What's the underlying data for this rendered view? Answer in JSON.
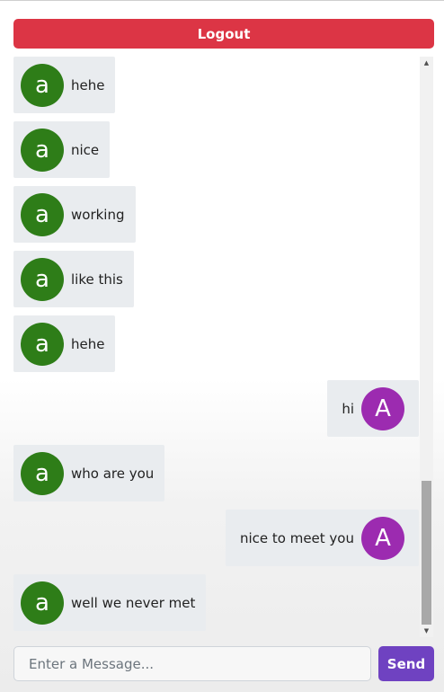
{
  "header": {
    "logout_label": "Logout"
  },
  "chat": {
    "messages": [
      {
        "side": "left",
        "avatar": "a",
        "text": "hehe"
      },
      {
        "side": "left",
        "avatar": "a",
        "text": "nice"
      },
      {
        "side": "left",
        "avatar": "a",
        "text": "working"
      },
      {
        "side": "left",
        "avatar": "a",
        "text": "like this"
      },
      {
        "side": "left",
        "avatar": "a",
        "text": "hehe"
      },
      {
        "side": "right",
        "avatar": "A",
        "text": "hi"
      },
      {
        "side": "left",
        "avatar": "a",
        "text": "who are you"
      },
      {
        "side": "right",
        "avatar": "A",
        "text": "nice to meet you"
      },
      {
        "side": "left",
        "avatar": "a",
        "text": "well we never met"
      }
    ]
  },
  "composer": {
    "placeholder": "Enter a Message...",
    "value": "",
    "send_label": "Send"
  },
  "colors": {
    "logout": "#dc3545",
    "send": "#6f42c1",
    "avatar_other": "#2e7d18",
    "avatar_self": "#9c2bb0",
    "bubble": "#e9ecef"
  }
}
